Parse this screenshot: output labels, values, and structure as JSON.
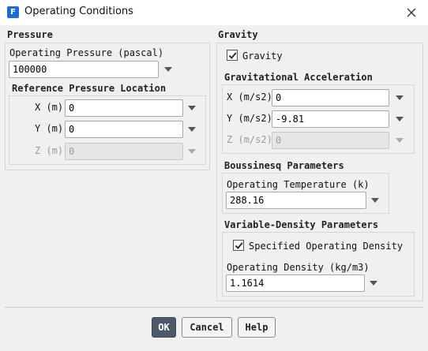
{
  "window": {
    "title": "Operating Conditions",
    "app_icon_letter": "F"
  },
  "pressure": {
    "title": "Pressure",
    "operating_pressure_label": "Operating Pressure (pascal)",
    "operating_pressure_value": "100000",
    "reference_location": {
      "title": "Reference Pressure Location",
      "x_label": "X (m)",
      "x_value": "0",
      "y_label": "Y (m)",
      "y_value": "0",
      "z_label": "Z (m)",
      "z_value": "0"
    }
  },
  "gravity": {
    "title": "Gravity",
    "checkbox_label": "Gravity",
    "checked": true,
    "acceleration": {
      "title": "Gravitational Acceleration",
      "x_label": "X (m/s2)",
      "x_value": "0",
      "y_label": "Y (m/s2)",
      "y_value": "-9.81",
      "z_label": "Z (m/s2)",
      "z_value": "0"
    }
  },
  "boussinesq": {
    "title": "Boussinesq Parameters",
    "temp_label": "Operating Temperature (k)",
    "temp_value": "288.16"
  },
  "variable_density": {
    "title": "Variable-Density Parameters",
    "checkbox_label": "Specified Operating Density",
    "checked": true,
    "density_label": "Operating Density (kg/m3)",
    "density_value": "1.1614"
  },
  "buttons": {
    "ok": "OK",
    "cancel": "Cancel",
    "help": "Help"
  }
}
